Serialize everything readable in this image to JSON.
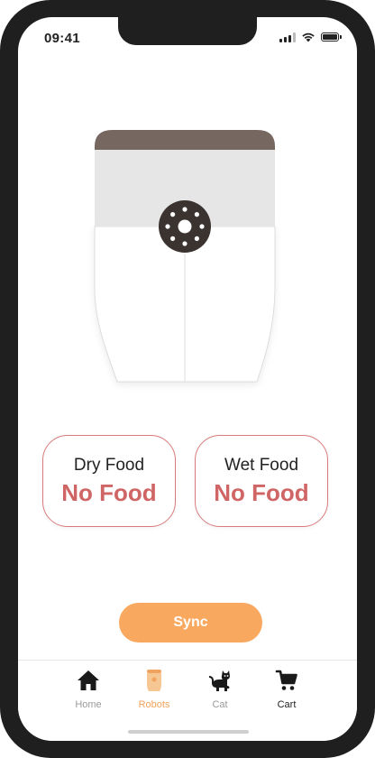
{
  "status_bar": {
    "time": "09:41"
  },
  "feeder": {
    "lid_color": "#766860",
    "hopper_color": "#e6e6e6",
    "dial_color": "#3a3330"
  },
  "food_cards": [
    {
      "label": "Dry Food",
      "status": "No Food"
    },
    {
      "label": "Wet Food",
      "status": "No Food"
    }
  ],
  "sync_button": {
    "label": "Sync",
    "color": "#f9a85f"
  },
  "tab_bar": {
    "tabs": [
      {
        "label": "Home",
        "icon": "house-icon"
      },
      {
        "label": "Robots",
        "icon": "feeder-icon",
        "active": true
      },
      {
        "label": "Cat",
        "icon": "cat-icon"
      },
      {
        "label": "Cart",
        "icon": "cart-icon"
      }
    ],
    "active_color": "#f3a25b"
  }
}
